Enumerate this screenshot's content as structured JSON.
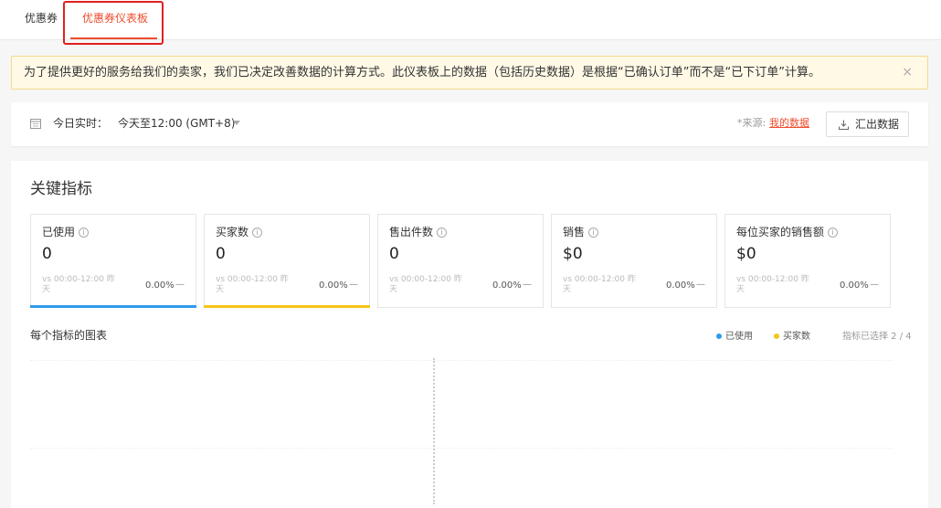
{
  "tabs": {
    "coupon": "优惠券",
    "dashboard": "优惠券仪表板"
  },
  "notice": {
    "text": "为了提供更好的服务给我们的卖家，我们已决定改善数据的计算方式。此仪表板上的数据（包括历史数据）是根据“已确认订单”而不是“已下订单”计算。",
    "close": "×"
  },
  "filter": {
    "label": "今日实时：",
    "value": "今天至12:00 (GMT+8)",
    "source_label": "*来源:",
    "source_link": "我的数据",
    "export": "汇出数据"
  },
  "section": {
    "title": "关键指标"
  },
  "metrics": [
    {
      "name": "已使用",
      "value": "0",
      "compare": "vs 00:00-12:00 昨天",
      "pct": "0.00%",
      "dash": "—",
      "accent": "#2d9ce8"
    },
    {
      "name": "买家数",
      "value": "0",
      "compare": "vs 00:00-12:00 昨天",
      "pct": "0.00%",
      "dash": "—",
      "accent": "#f5c518"
    },
    {
      "name": "售出件数",
      "value": "0",
      "compare": "vs 00:00-12:00 昨天",
      "pct": "0.00%",
      "dash": "—"
    },
    {
      "name": "销售",
      "value": "$0",
      "compare": "vs 00:00-12:00 昨天",
      "pct": "0.00%",
      "dash": "—"
    },
    {
      "name": "每位买家的销售额",
      "value": "$0",
      "compare": "vs 00:00-12:00 昨天",
      "pct": "0.00%",
      "dash": "—"
    }
  ],
  "chart": {
    "title": "每个指标的图表",
    "legend": [
      {
        "name": "已使用",
        "color": "#2d9ce8"
      },
      {
        "name": "买家数",
        "color": "#f5c518"
      }
    ],
    "selected": "指标已选择 2 / 4"
  },
  "icons": {
    "calendar": "calendar-icon",
    "info": "info-icon",
    "download": "download-icon",
    "close": "close-icon",
    "caret": "chevron-down-icon"
  }
}
